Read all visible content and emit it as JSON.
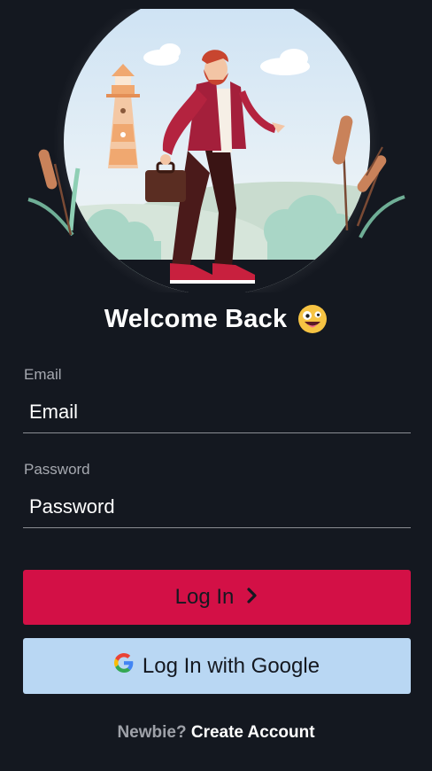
{
  "header": {
    "title": "Welcome Back"
  },
  "icons": {
    "title_emoji": "zany-face-icon",
    "login_arrow": "chevron-right-icon",
    "google": "google-icon"
  },
  "form": {
    "email_label": "Email",
    "email_placeholder": "Email",
    "email_value": "",
    "password_label": "Password",
    "password_placeholder": "Password",
    "password_value": ""
  },
  "buttons": {
    "login_label": "Log In",
    "google_label": "Log In with Google"
  },
  "footer": {
    "prompt": "Newbie?",
    "link": "Create Account"
  },
  "colors": {
    "background": "#141820",
    "primary": "#d31046",
    "google_button": "#b9d7f3",
    "text": "#ffffff",
    "muted_text": "#a6a9b0"
  }
}
